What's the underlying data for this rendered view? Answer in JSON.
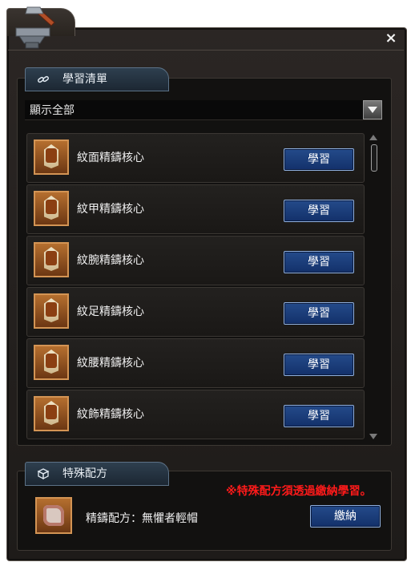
{
  "window": {
    "close_label": "×"
  },
  "learning_list": {
    "section_title": "學習清單",
    "filter": {
      "selected": "顯示全部"
    },
    "items": [
      {
        "name": "紋面精鑄核心",
        "button": "學習"
      },
      {
        "name": "紋甲精鑄核心",
        "button": "學習"
      },
      {
        "name": "紋腕精鑄核心",
        "button": "學習"
      },
      {
        "name": "紋足精鑄核心",
        "button": "學習"
      },
      {
        "name": "紋腰精鑄核心",
        "button": "學習"
      },
      {
        "name": "紋飾精鑄核心",
        "button": "學習"
      }
    ]
  },
  "special_recipe": {
    "section_title": "特殊配方",
    "notice": "※特殊配方須透過繳納學習。",
    "recipe_name": "精鑄配方：無懼者輕帽",
    "submit_button": "繳納"
  },
  "colors": {
    "accent_button": "#1d3f7c",
    "notice_red": "#ff1a1a",
    "item_frame": "#d39454"
  },
  "icons": {
    "window": "anvil-hammer-icon",
    "learning_section": "chain-link-icon",
    "special_section": "box-icon",
    "dropdown": "chevron-down-icon",
    "item": "core-crystal-icon",
    "recipe": "recipe-scroll-icon"
  }
}
